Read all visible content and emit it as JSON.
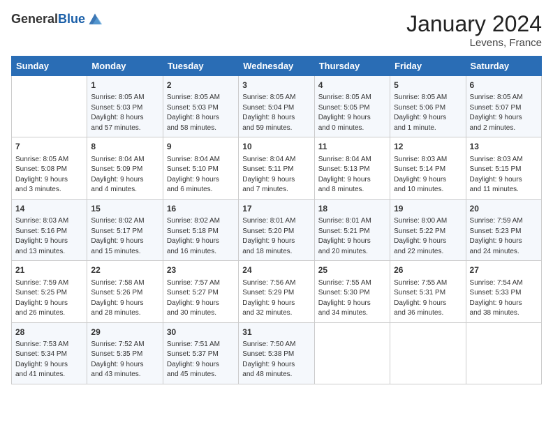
{
  "logo": {
    "general": "General",
    "blue": "Blue"
  },
  "title": "January 2024",
  "subtitle": "Levens, France",
  "days_header": [
    "Sunday",
    "Monday",
    "Tuesday",
    "Wednesday",
    "Thursday",
    "Friday",
    "Saturday"
  ],
  "weeks": [
    [
      {
        "day": "",
        "info": ""
      },
      {
        "day": "1",
        "info": "Sunrise: 8:05 AM\nSunset: 5:03 PM\nDaylight: 8 hours\nand 57 minutes."
      },
      {
        "day": "2",
        "info": "Sunrise: 8:05 AM\nSunset: 5:03 PM\nDaylight: 8 hours\nand 58 minutes."
      },
      {
        "day": "3",
        "info": "Sunrise: 8:05 AM\nSunset: 5:04 PM\nDaylight: 8 hours\nand 59 minutes."
      },
      {
        "day": "4",
        "info": "Sunrise: 8:05 AM\nSunset: 5:05 PM\nDaylight: 9 hours\nand 0 minutes."
      },
      {
        "day": "5",
        "info": "Sunrise: 8:05 AM\nSunset: 5:06 PM\nDaylight: 9 hours\nand 1 minute."
      },
      {
        "day": "6",
        "info": "Sunrise: 8:05 AM\nSunset: 5:07 PM\nDaylight: 9 hours\nand 2 minutes."
      }
    ],
    [
      {
        "day": "7",
        "info": "Sunrise: 8:05 AM\nSunset: 5:08 PM\nDaylight: 9 hours\nand 3 minutes."
      },
      {
        "day": "8",
        "info": "Sunrise: 8:04 AM\nSunset: 5:09 PM\nDaylight: 9 hours\nand 4 minutes."
      },
      {
        "day": "9",
        "info": "Sunrise: 8:04 AM\nSunset: 5:10 PM\nDaylight: 9 hours\nand 6 minutes."
      },
      {
        "day": "10",
        "info": "Sunrise: 8:04 AM\nSunset: 5:11 PM\nDaylight: 9 hours\nand 7 minutes."
      },
      {
        "day": "11",
        "info": "Sunrise: 8:04 AM\nSunset: 5:13 PM\nDaylight: 9 hours\nand 8 minutes."
      },
      {
        "day": "12",
        "info": "Sunrise: 8:03 AM\nSunset: 5:14 PM\nDaylight: 9 hours\nand 10 minutes."
      },
      {
        "day": "13",
        "info": "Sunrise: 8:03 AM\nSunset: 5:15 PM\nDaylight: 9 hours\nand 11 minutes."
      }
    ],
    [
      {
        "day": "14",
        "info": "Sunrise: 8:03 AM\nSunset: 5:16 PM\nDaylight: 9 hours\nand 13 minutes."
      },
      {
        "day": "15",
        "info": "Sunrise: 8:02 AM\nSunset: 5:17 PM\nDaylight: 9 hours\nand 15 minutes."
      },
      {
        "day": "16",
        "info": "Sunrise: 8:02 AM\nSunset: 5:18 PM\nDaylight: 9 hours\nand 16 minutes."
      },
      {
        "day": "17",
        "info": "Sunrise: 8:01 AM\nSunset: 5:20 PM\nDaylight: 9 hours\nand 18 minutes."
      },
      {
        "day": "18",
        "info": "Sunrise: 8:01 AM\nSunset: 5:21 PM\nDaylight: 9 hours\nand 20 minutes."
      },
      {
        "day": "19",
        "info": "Sunrise: 8:00 AM\nSunset: 5:22 PM\nDaylight: 9 hours\nand 22 minutes."
      },
      {
        "day": "20",
        "info": "Sunrise: 7:59 AM\nSunset: 5:23 PM\nDaylight: 9 hours\nand 24 minutes."
      }
    ],
    [
      {
        "day": "21",
        "info": "Sunrise: 7:59 AM\nSunset: 5:25 PM\nDaylight: 9 hours\nand 26 minutes."
      },
      {
        "day": "22",
        "info": "Sunrise: 7:58 AM\nSunset: 5:26 PM\nDaylight: 9 hours\nand 28 minutes."
      },
      {
        "day": "23",
        "info": "Sunrise: 7:57 AM\nSunset: 5:27 PM\nDaylight: 9 hours\nand 30 minutes."
      },
      {
        "day": "24",
        "info": "Sunrise: 7:56 AM\nSunset: 5:29 PM\nDaylight: 9 hours\nand 32 minutes."
      },
      {
        "day": "25",
        "info": "Sunrise: 7:55 AM\nSunset: 5:30 PM\nDaylight: 9 hours\nand 34 minutes."
      },
      {
        "day": "26",
        "info": "Sunrise: 7:55 AM\nSunset: 5:31 PM\nDaylight: 9 hours\nand 36 minutes."
      },
      {
        "day": "27",
        "info": "Sunrise: 7:54 AM\nSunset: 5:33 PM\nDaylight: 9 hours\nand 38 minutes."
      }
    ],
    [
      {
        "day": "28",
        "info": "Sunrise: 7:53 AM\nSunset: 5:34 PM\nDaylight: 9 hours\nand 41 minutes."
      },
      {
        "day": "29",
        "info": "Sunrise: 7:52 AM\nSunset: 5:35 PM\nDaylight: 9 hours\nand 43 minutes."
      },
      {
        "day": "30",
        "info": "Sunrise: 7:51 AM\nSunset: 5:37 PM\nDaylight: 9 hours\nand 45 minutes."
      },
      {
        "day": "31",
        "info": "Sunrise: 7:50 AM\nSunset: 5:38 PM\nDaylight: 9 hours\nand 48 minutes."
      },
      {
        "day": "",
        "info": ""
      },
      {
        "day": "",
        "info": ""
      },
      {
        "day": "",
        "info": ""
      }
    ]
  ]
}
